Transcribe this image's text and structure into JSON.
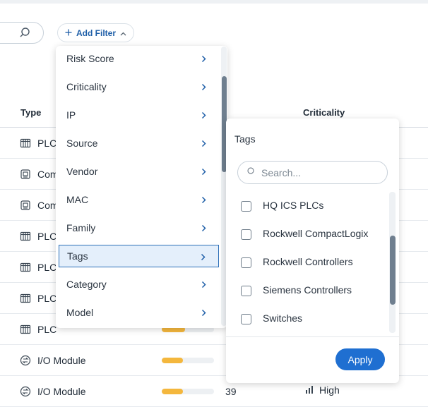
{
  "toolbar": {
    "add_filter_label": "Add Filter"
  },
  "table": {
    "columns": {
      "type": "Type",
      "criticality": "Criticality"
    },
    "rows": [
      {
        "type": "PLC",
        "icon": "plc-icon"
      },
      {
        "type": "Communication Module",
        "icon": "comm-module-icon"
      },
      {
        "type": "Communication Module",
        "icon": "comm-module-icon"
      },
      {
        "type": "PLC",
        "icon": "plc-icon"
      },
      {
        "type": "PLC",
        "icon": "plc-icon"
      },
      {
        "type": "PLC",
        "icon": "plc-icon"
      },
      {
        "type": "PLC",
        "icon": "plc-icon",
        "risk_fraction": 0.45
      },
      {
        "type": "I/O Module",
        "icon": "io-module-icon",
        "risk_fraction": 0.4
      },
      {
        "type": "I/O Module",
        "icon": "io-module-icon",
        "risk_fraction": 0.4,
        "risk_score": "39",
        "criticality": "High"
      }
    ]
  },
  "filter_menu": {
    "items": [
      "Risk Score",
      "Criticality",
      "IP",
      "Source",
      "Vendor",
      "MAC",
      "Family",
      "Tags",
      "Category",
      "Model"
    ],
    "active": "Tags"
  },
  "tags_panel": {
    "title": "Tags",
    "search_placeholder": "Search...",
    "options": [
      "HQ ICS PLCs",
      "Rockwell CompactLogix",
      "Rockwell Controllers",
      "Siemens Controllers",
      "Switches"
    ],
    "apply_label": "Apply"
  },
  "colors": {
    "accent": "#1f6fd1",
    "risk_bar": "#f4b73d",
    "menu_active_bg": "#e4effb"
  }
}
